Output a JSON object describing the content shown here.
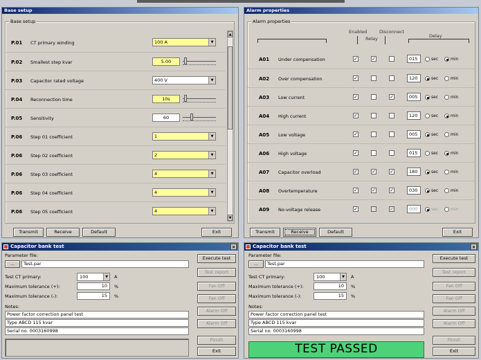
{
  "base": {
    "title": "Base setup",
    "group": "Base setup",
    "rows": [
      {
        "code": "P.01",
        "label": "CT primary winding",
        "value": "100 A",
        "kind": "combo-yellow"
      },
      {
        "code": "P.02",
        "label": "Smallest step kvar",
        "value": "5.00",
        "kind": "spin-yellow-slider",
        "slider": 0.05
      },
      {
        "code": "P.03",
        "label": "Capacitor rated voltage",
        "value": "400 V",
        "kind": "combo-white"
      },
      {
        "code": "P.04",
        "label": "Reconnection time",
        "value": "10s",
        "kind": "spin-yellow-slider",
        "slider": 0.05
      },
      {
        "code": "P.05",
        "label": "Sensitivity",
        "value": "60",
        "kind": "spin-white-slider",
        "slider": 0.25
      },
      {
        "code": "P.06",
        "label": "Step 01 coefficient",
        "value": "1",
        "kind": "combo-yellow"
      },
      {
        "code": "P.06",
        "label": "Step 02 coefficient",
        "value": "2",
        "kind": "combo-yellow"
      },
      {
        "code": "P.06",
        "label": "Step 03 coefficient",
        "value": "4",
        "kind": "combo-yellow"
      },
      {
        "code": "P.06",
        "label": "Step 04 coefficient",
        "value": "4",
        "kind": "combo-yellow"
      },
      {
        "code": "P.06",
        "label": "Step 05 coefficient",
        "value": "4",
        "kind": "combo-yellow"
      }
    ],
    "buttons": {
      "transmit": "Transmit",
      "receive": "Receive",
      "default": "Default",
      "exit": "Exit"
    }
  },
  "alarm": {
    "title": "Alarm properties",
    "group": "Alarm properties",
    "headers": {
      "enabled": "Enabled",
      "relay": "Relay",
      "disconnect": "Disconnect",
      "delay": "Delay"
    },
    "sec": "sec",
    "min": "min",
    "rows": [
      {
        "code": "A01",
        "label": "Under compensation",
        "enabled": true,
        "relay": true,
        "disconnect": false,
        "delay": "015",
        "unit": "min",
        "disabled": false
      },
      {
        "code": "A02",
        "label": "Over compensation",
        "enabled": true,
        "relay": false,
        "disconnect": false,
        "delay": "120",
        "unit": "sec",
        "disabled": false
      },
      {
        "code": "A03",
        "label": "Low current",
        "enabled": true,
        "relay": false,
        "disconnect": true,
        "delay": "005",
        "unit": "sec",
        "disabled": false
      },
      {
        "code": "A04",
        "label": "High current",
        "enabled": true,
        "relay": false,
        "disconnect": false,
        "delay": "120",
        "unit": "min",
        "disabled": false
      },
      {
        "code": "A05",
        "label": "Low voltage",
        "enabled": true,
        "relay": false,
        "disconnect": false,
        "delay": "005",
        "unit": "sec",
        "disabled": false
      },
      {
        "code": "A06",
        "label": "High voltage",
        "enabled": true,
        "relay": false,
        "disconnect": false,
        "delay": "015",
        "unit": "min",
        "disabled": false
      },
      {
        "code": "A07",
        "label": "Capacitor overload",
        "enabled": true,
        "relay": true,
        "disconnect": true,
        "delay": "180",
        "unit": "sec",
        "disabled": false
      },
      {
        "code": "A08",
        "label": "Overtemperature",
        "enabled": true,
        "relay": true,
        "disconnect": true,
        "delay": "030",
        "unit": "sec",
        "disabled": false
      },
      {
        "code": "A09",
        "label": "No-voltage release",
        "enabled": true,
        "relay": false,
        "disconnect": true,
        "delay": "000",
        "unit": "sec",
        "disabled": true
      }
    ],
    "buttons": {
      "transmit": "Transmit",
      "receive": "Receive",
      "default": "Default",
      "exit": "Exit"
    }
  },
  "test_left": {
    "title": "Capacitor bank test",
    "param_label": "Parameter file:",
    "browse": "...",
    "file": "Test.par",
    "ct_label": "Test CT primary:",
    "ct_value": "100",
    "ct_unit": "A",
    "tolp_label": "Maximum tolerance (+):",
    "tolp_value": "10",
    "tolm_label": "Maximum tolerance (-):",
    "tolm_value": "15",
    "pct": "%",
    "notes_label": "Notes:",
    "notes": [
      "Power factor correction panel test",
      "Type ABCD 115 kvar",
      "Serial no. 0003160998"
    ],
    "side": [
      "Execute test",
      "Test report",
      "Fan Off",
      "Fan Off",
      "Alarm Off",
      "Alarm Off",
      "Finish",
      "Exit"
    ],
    "side_enabled": [
      true,
      false,
      false,
      false,
      false,
      false,
      false,
      true
    ]
  },
  "test_right": {
    "title": "Capacitor bank test",
    "param_label": "Parameter file:",
    "browse": "...",
    "file": "Test.par",
    "ct_label": "Test CT primary:",
    "ct_value": "100",
    "ct_unit": "A",
    "tolp_label": "Maximum tolerance (+):",
    "tolp_value": "10",
    "tolm_label": "Maximum tolerance (-):",
    "tolm_value": "15",
    "pct": "%",
    "notes_label": "Notes:",
    "notes": [
      "Power factor correction panel test",
      "Type ABCD 115 kvar",
      "Serial no. 0003160998"
    ],
    "banner": "TEST PASSED",
    "side": [
      "Execute test",
      "Test report",
      "Fan Off",
      "Fan Off",
      "Alarm Off",
      "Alarm Off",
      "Finish",
      "Exit"
    ],
    "side_enabled": [
      true,
      false,
      false,
      false,
      false,
      false,
      false,
      true
    ]
  }
}
